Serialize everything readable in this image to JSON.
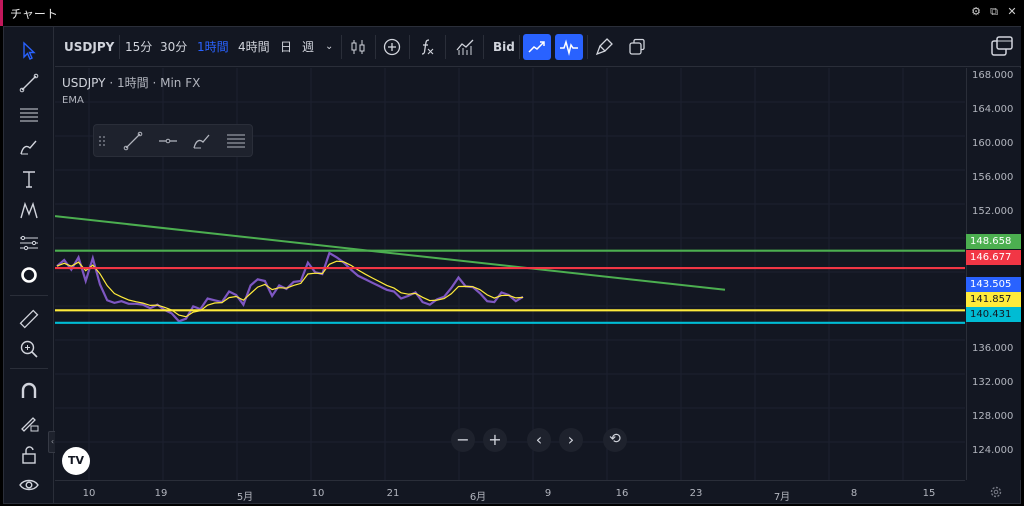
{
  "window": {
    "title": "チャート"
  },
  "toolbar": {
    "symbol": "USDJPY",
    "intervals": [
      "15分",
      "30分",
      "1時間",
      "4時間",
      "日",
      "週"
    ],
    "active_interval": "1時間",
    "price_source": "Bid"
  },
  "legend": {
    "symbol": "USDJPY",
    "sep1": "·",
    "interval": "1時間",
    "sep2": "·",
    "source": "Min FX",
    "indicator": "EMA"
  },
  "price_scale": {
    "ticks": [
      "168.000",
      "164.000",
      "160.000",
      "156.000",
      "152.000",
      "136.000",
      "132.000",
      "128.000",
      "124.000"
    ],
    "labels": [
      {
        "value": "148.658",
        "color": "#4caf50",
        "text_color": "#ffffff"
      },
      {
        "value": "146.677",
        "color": "#f23645",
        "text_color": "#ffffff"
      },
      {
        "value": "143.505",
        "color": "#2962ff",
        "text_color": "#ffffff"
      },
      {
        "value": "141.857",
        "color": "#ffeb3b",
        "text_color": "#131722"
      },
      {
        "value": "140.431",
        "color": "#00bcd4",
        "text_color": "#131722"
      }
    ]
  },
  "time_scale": {
    "ticks": [
      "10",
      "19",
      "5月",
      "10",
      "21",
      "6月",
      "9",
      "16",
      "23",
      "7月",
      "8",
      "15"
    ]
  },
  "navigation": {
    "zoom_out": "−",
    "zoom_in": "+",
    "scroll_left": "‹",
    "scroll_right": "›",
    "reset": "⟲"
  },
  "chart_data": {
    "type": "line",
    "symbol": "USDJPY",
    "price_axis_range": [
      122.5,
      169.5
    ],
    "horizontal_lines": [
      {
        "price": 148.658,
        "color": "#4caf50"
      },
      {
        "price": 146.677,
        "color": "#f23645"
      },
      {
        "price": 141.857,
        "color": "#ffeb3b"
      },
      {
        "price": 140.431,
        "color": "#00bcd4"
      }
    ],
    "current_price": 143.505,
    "trendline": {
      "color": "#4caf50",
      "start_price": 152.6,
      "end_price": 144.2
    },
    "colors": {
      "price": "#7e57c2",
      "ema": "#ffeb3b"
    },
    "series": [
      {
        "values": [
          146.9,
          147.6,
          146.5,
          147.9,
          145.2,
          147.8,
          144.8,
          143.0,
          142.7,
          142.9,
          142.6,
          142.6,
          142.5,
          142.1,
          142.5,
          141.9,
          141.5,
          140.6,
          140.9,
          142.3,
          142.0,
          143.2,
          143.0,
          142.8,
          144.0,
          143.6,
          142.5,
          144.7,
          145.4,
          145.2,
          143.5,
          144.7,
          144.3,
          145.1,
          145.2,
          147.3,
          146.2,
          146.0,
          148.4,
          147.9,
          147.3,
          146.5,
          145.8,
          145.4,
          145.0,
          144.6,
          144.2,
          144.0,
          143.2,
          143.5,
          143.9,
          142.8,
          142.5,
          143.1,
          143.4,
          144.4,
          145.6,
          144.6,
          144.5,
          143.8,
          142.9,
          142.8,
          143.9,
          143.6,
          142.9,
          143.4
        ]
      }
    ]
  }
}
